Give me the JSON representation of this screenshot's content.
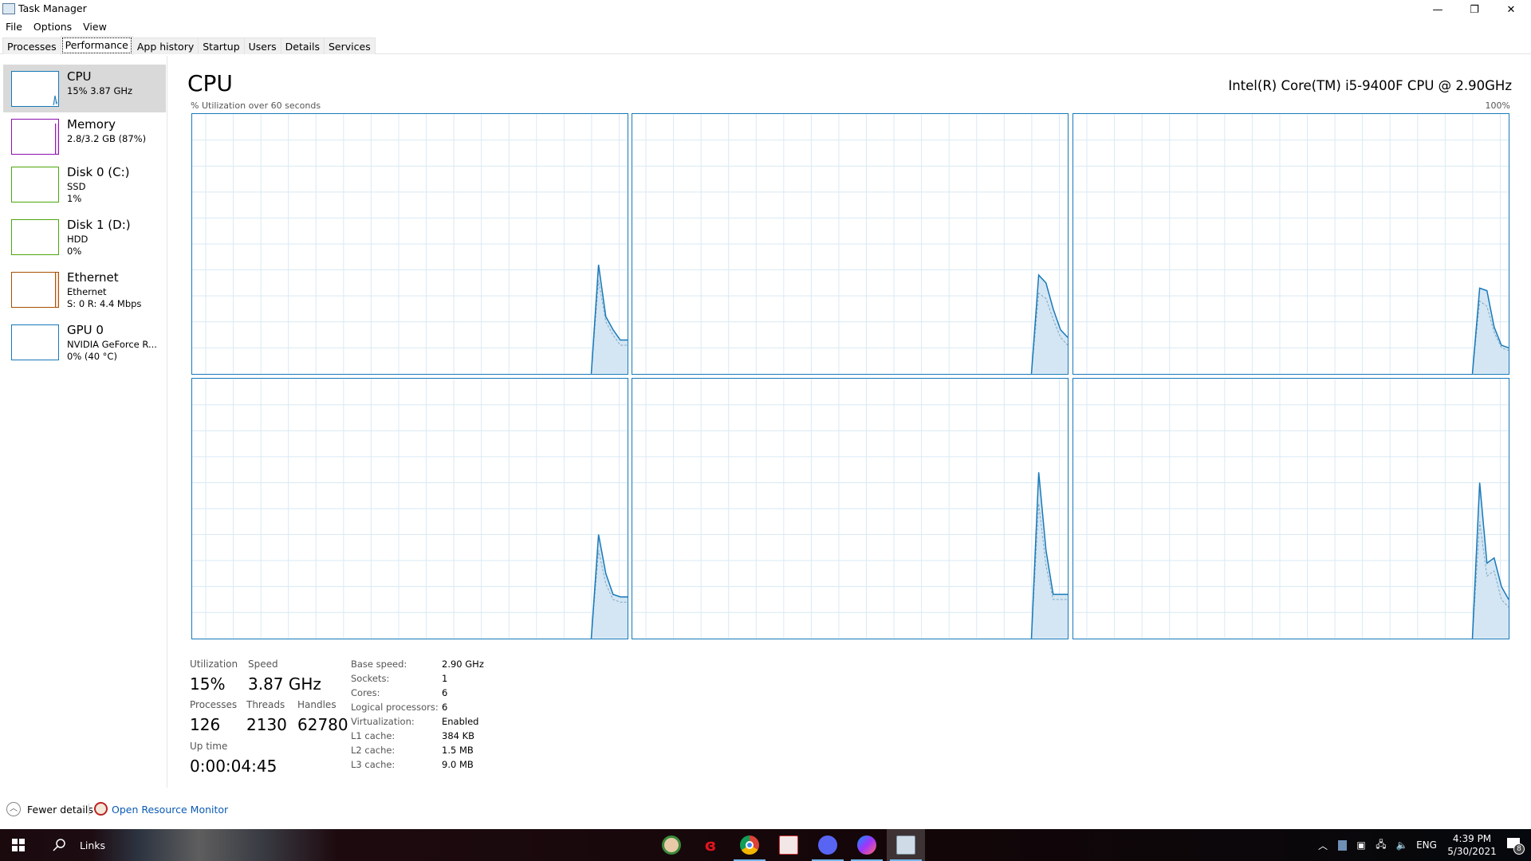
{
  "window": {
    "title": "Task Manager",
    "controls": {
      "minimize": "—",
      "restore": "❐",
      "close": "✕"
    }
  },
  "menu": [
    "File",
    "Options",
    "View"
  ],
  "tabs": [
    {
      "label": "Processes",
      "active": false
    },
    {
      "label": "Performance",
      "active": true
    },
    {
      "label": "App history",
      "active": false
    },
    {
      "label": "Startup",
      "active": false
    },
    {
      "label": "Users",
      "active": false
    },
    {
      "label": "Details",
      "active": false
    },
    {
      "label": "Services",
      "active": false
    }
  ],
  "sidebar": {
    "items": [
      {
        "name": "CPU",
        "line1": "15% 3.87 GHz",
        "line2": "",
        "color": "#1779ba",
        "active": true
      },
      {
        "name": "Memory",
        "line1": "2.8/3.2 GB (87%)",
        "line2": "",
        "color": "#8b12ae",
        "active": false
      },
      {
        "name": "Disk 0 (C:)",
        "line1": "SSD",
        "line2": "1%",
        "color": "#4da60c",
        "active": false
      },
      {
        "name": "Disk 1 (D:)",
        "line1": "HDD",
        "line2": "0%",
        "color": "#4da60c",
        "active": false
      },
      {
        "name": "Ethernet",
        "line1": "Ethernet",
        "line2": "S: 0 R: 4.4 Mbps",
        "color": "#a74f01",
        "active": false
      },
      {
        "name": "GPU 0",
        "line1": "NVIDIA GeForce R...",
        "line2": "0% (40 °C)",
        "color": "#1779ba",
        "active": false
      }
    ]
  },
  "main": {
    "title": "CPU",
    "cpu_model": "Intel(R) Core(TM) i5-9400F CPU @ 2.90GHz",
    "axis_label": "% Utilization over 60 seconds",
    "axis_max": "100%"
  },
  "chart_data": {
    "type": "area",
    "title": "% Utilization over 60 seconds",
    "ylim": [
      0,
      100
    ],
    "xlim": [
      0,
      60
    ],
    "x_unit": "seconds",
    "grid": true,
    "line_color": "#1779ba",
    "fill_color": "#d4e6f3",
    "series": [
      {
        "name": "Logical processor 0",
        "x": [
          55,
          56,
          57,
          58,
          59,
          60
        ],
        "values": [
          0,
          42,
          22,
          17,
          13,
          13
        ],
        "kernel": [
          0,
          36,
          20,
          15,
          11,
          11
        ]
      },
      {
        "name": "Logical processor 1",
        "x": [
          55,
          56,
          57,
          58,
          59,
          60
        ],
        "values": [
          0,
          38,
          35,
          25,
          17,
          14
        ],
        "kernel": [
          0,
          31,
          29,
          21,
          14,
          11
        ]
      },
      {
        "name": "Logical processor 2",
        "x": [
          55,
          56,
          57,
          58,
          59,
          60
        ],
        "values": [
          0,
          33,
          32,
          18,
          11,
          10
        ],
        "kernel": [
          0,
          28,
          26,
          16,
          10,
          9
        ]
      },
      {
        "name": "Logical processor 3",
        "x": [
          55,
          56,
          57,
          58,
          59,
          60
        ],
        "values": [
          0,
          40,
          25,
          17,
          16,
          16
        ],
        "kernel": [
          0,
          34,
          21,
          15,
          14,
          14
        ]
      },
      {
        "name": "Logical processor 4",
        "x": [
          55,
          56,
          57,
          58,
          59,
          60
        ],
        "values": [
          0,
          64,
          34,
          17,
          17,
          17
        ],
        "kernel": [
          0,
          52,
          28,
          15,
          15,
          15
        ]
      },
      {
        "name": "Logical processor 5",
        "x": [
          55,
          56,
          57,
          58,
          59,
          60
        ],
        "values": [
          0,
          60,
          29,
          31,
          20,
          15
        ],
        "kernel": [
          0,
          45,
          24,
          26,
          15,
          12
        ]
      }
    ]
  },
  "stats": {
    "utilization_label": "Utilization",
    "utilization": "15%",
    "speed_label": "Speed",
    "speed": "3.87 GHz",
    "processes_label": "Processes",
    "processes": "126",
    "threads_label": "Threads",
    "threads": "2130",
    "handles_label": "Handles",
    "handles": "62780",
    "uptime_label": "Up time",
    "uptime": "0:00:04:45"
  },
  "specs": [
    {
      "label": "Base speed:",
      "value": "2.90 GHz"
    },
    {
      "label": "Sockets:",
      "value": "1"
    },
    {
      "label": "Cores:",
      "value": "6"
    },
    {
      "label": "Logical processors:",
      "value": "6"
    },
    {
      "label": "Virtualization:",
      "value": "Enabled"
    },
    {
      "label": "L1 cache:",
      "value": "384 KB"
    },
    {
      "label": "L2 cache:",
      "value": "1.5 MB"
    },
    {
      "label": "L3 cache:",
      "value": "9.0 MB"
    }
  ],
  "footer": {
    "fewer_details": "Fewer details",
    "open_resource_monitor": "Open Resource Monitor"
  },
  "taskbar": {
    "search_label": "Links",
    "apps": [
      "game-character-app",
      "garena-app",
      "chrome",
      "unikey",
      "discord",
      "messenger",
      "task-manager"
    ],
    "language": "ENG",
    "time": "4:39 PM",
    "date": "5/30/2021",
    "notification_count": "8"
  }
}
